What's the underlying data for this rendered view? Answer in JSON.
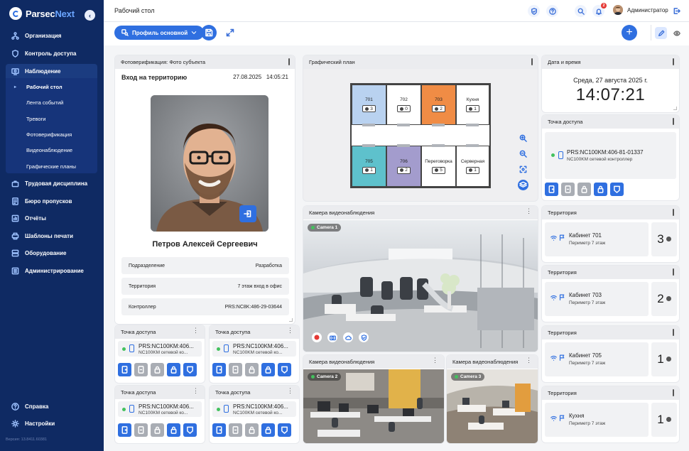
{
  "app": {
    "brand_a": "Parsec",
    "brand_b": "Next",
    "version": "Версия: 13.8411.60381"
  },
  "nav": {
    "items": [
      {
        "label": "Организация",
        "icon": "org-icon"
      },
      {
        "label": "Контроль доступа",
        "icon": "shield-icon"
      },
      {
        "label": "Наблюдение",
        "icon": "monitor-icon",
        "selected": true
      },
      {
        "label": "Трудовая дисциплина",
        "icon": "work-icon"
      },
      {
        "label": "Бюро пропусков",
        "icon": "badge-icon"
      },
      {
        "label": "Отчёты",
        "icon": "chart-icon"
      },
      {
        "label": "Шаблоны печати",
        "icon": "print-icon"
      },
      {
        "label": "Оборудование",
        "icon": "server-icon"
      },
      {
        "label": "Администрирование",
        "icon": "admin-icon"
      }
    ],
    "sub": [
      "Рабочий стол",
      "Лента событий",
      "Тревоги",
      "Фотоверификация",
      "Видеонаблюдение",
      "Графические планы"
    ],
    "help": "Справка",
    "settings": "Настройки"
  },
  "top": {
    "title": "Рабочий стол",
    "user": "Администратор",
    "notifications": "2"
  },
  "toolbar": {
    "profile": "Профиль основной"
  },
  "photo": {
    "header": "Фотоверификация: Фото субъекта",
    "event": "Вход на территорию",
    "date": "27.08.2025",
    "time": "14:05:21",
    "name": "Петров Алексей Сергеевич",
    "rows": [
      {
        "label": "Подразделение",
        "value": "Разработка"
      },
      {
        "label": "Территория",
        "value": "7 этаж вход в офис"
      },
      {
        "label": "Контроллер",
        "value": "PRS:NC8K:486-29-03644"
      }
    ]
  },
  "ap_small": [
    {
      "header": "Точка доступа",
      "name": "PRS:NC100KM:406...",
      "type": "NC100KM сетевой ко..."
    },
    {
      "header": "Точка доступа",
      "name": "PRS:NC100KM:406...",
      "type": "NC100KM сетевой ко..."
    },
    {
      "header": "Точка доступа",
      "name": "PRS:NC100KM:406...",
      "type": "NC100KM сетевой ко..."
    },
    {
      "header": "Точка доступа",
      "name": "PRS:NC100KM:406...",
      "type": "NC100KM сетевой ко..."
    }
  ],
  "plan": {
    "header": "Графический план",
    "rooms": [
      {
        "name": "701",
        "count": "3",
        "color": "#b9d2f0"
      },
      {
        "name": "702",
        "count": "0",
        "color": "#ffffff"
      },
      {
        "name": "703",
        "count": "2",
        "color": "#f08c45"
      },
      {
        "name": "Кухня",
        "count": "1",
        "color": "#ffffff"
      },
      {
        "name": "705",
        "count": "1",
        "color": "#5ec1cc"
      },
      {
        "name": "706",
        "count": "2",
        "color": "#a39ccd"
      },
      {
        "name": "Переговорка",
        "count": "5",
        "color": "#ffffff"
      },
      {
        "name": "Серверная",
        "count": "1",
        "color": "#ffffff"
      }
    ]
  },
  "cameras": [
    {
      "header": "Камера видеонаблюдения",
      "label": "Camera 1"
    },
    {
      "header": "Камера видеонаблюдения",
      "label": "Camera 2"
    },
    {
      "header": "Камера видеонаблюдения",
      "label": "Camera 3"
    }
  ],
  "datetime": {
    "header": "Дата и время",
    "date": "Среда, 27 августа 2025 г.",
    "time": "14:07:21"
  },
  "ap_big": {
    "header": "Точка доступа",
    "name": "PRS:NC100KM:406-81-01337",
    "type": "NC100KM сетевой контроллер"
  },
  "territories": [
    {
      "header": "Территория",
      "name": "Кабинет 701",
      "sub": "Периметр 7 этаж",
      "count": "3"
    },
    {
      "header": "Территория",
      "name": "Кабинет 703",
      "sub": "Периметр 7 этаж",
      "count": "2"
    },
    {
      "header": "Территория",
      "name": "Кабинет 705",
      "sub": "Периметр 7 этаж",
      "count": "1"
    },
    {
      "header": "Территория",
      "name": "Кухня",
      "sub": "Периметр 7 этаж",
      "count": "1"
    }
  ],
  "colors": {
    "sidebar": "#0f2a63",
    "accent": "#2f6fe0",
    "online": "#43c15e",
    "alert": "#e53935"
  }
}
